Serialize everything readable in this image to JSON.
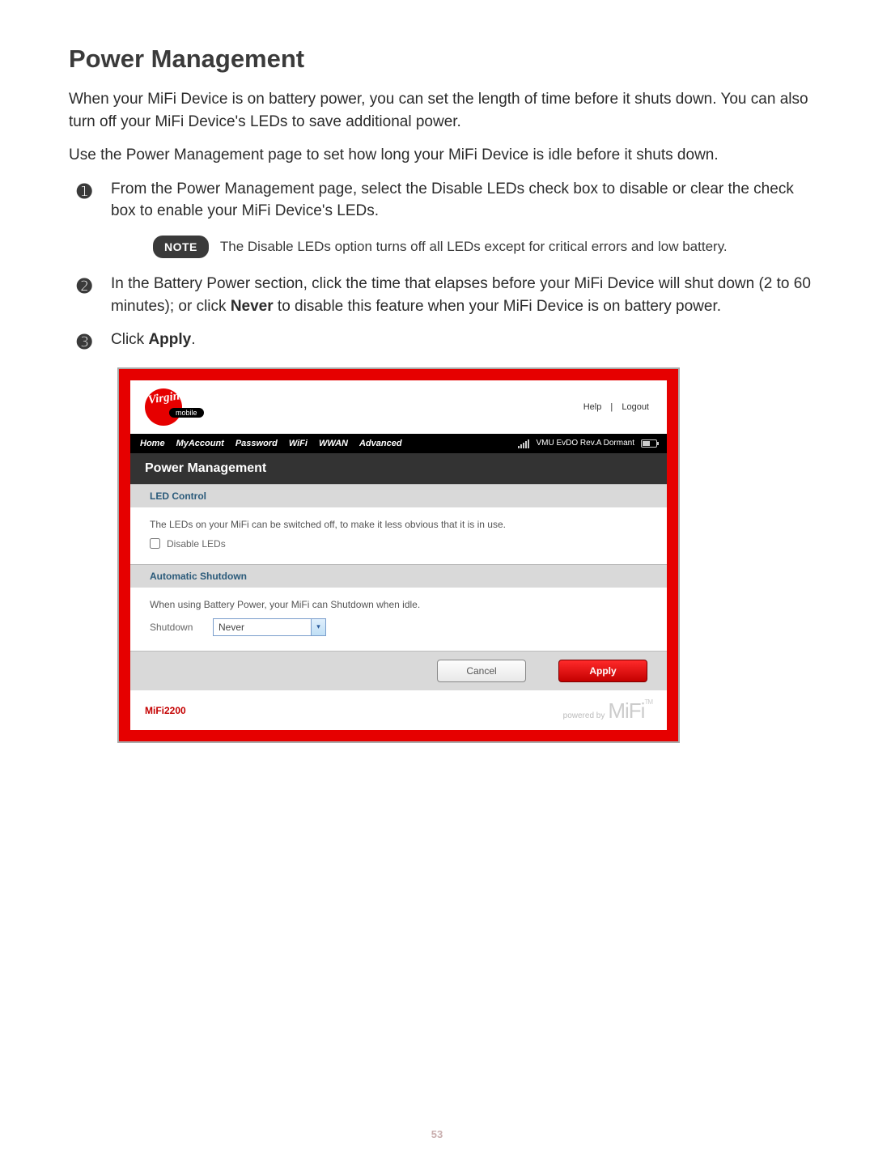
{
  "title": "Power Management",
  "intro_p1": "When your MiFi Device is on battery power, you can set the length of time before it shuts down. You can also turn off your MiFi Device's LEDs to save additional power.",
  "intro_p2": "Use the Power Management page to set how long your MiFi Device is idle before it shuts down.",
  "steps": {
    "s1_num": "➊",
    "s1_text": "From the Power Management page, select the Disable LEDs check box to disable or clear the check box to enable your MiFi Device's LEDs.",
    "note_label": "NOTE",
    "note_text": "The Disable LEDs option turns off all LEDs except for critical errors and low battery.",
    "s2_num": "➋",
    "s2_a": "In the Battery Power section, click the time that elapses before your MiFi Device will shut down (2 to 60 minutes); or click ",
    "s2_bold1": "Never",
    "s2_b": " to disable this feature when your MiFi Device is on battery power.",
    "s3_num": "➌",
    "s3_a": "Click ",
    "s3_bold1": "Apply",
    "s3_b": "."
  },
  "mock": {
    "logo_script": "Virgin",
    "logo_mobile": "mobile",
    "header_help": "Help",
    "header_sep": "|",
    "header_logout": "Logout",
    "nav": {
      "home": "Home",
      "myaccount": "MyAccount",
      "password": "Password",
      "wifi": "WiFi",
      "wwan": "WWAN",
      "advanced": "Advanced",
      "status_text": "VMU  EvDO Rev.A  Dormant"
    },
    "panel_title": "Power Management",
    "led": {
      "heading": "LED Control",
      "desc": "The LEDs on your MiFi can be switched off, to make it less obvious that it is in use.",
      "checkbox_label": "Disable LEDs"
    },
    "shutdown": {
      "heading": "Automatic Shutdown",
      "desc": "When using Battery Power, your MiFi can Shutdown when idle.",
      "label": "Shutdown",
      "selected": "Never"
    },
    "buttons": {
      "cancel": "Cancel",
      "apply": "Apply"
    },
    "footer_model": "MiFi2200",
    "footer_powered": "powered by",
    "footer_brand": "MiFi",
    "footer_tm": "TM"
  },
  "page_number": "53"
}
